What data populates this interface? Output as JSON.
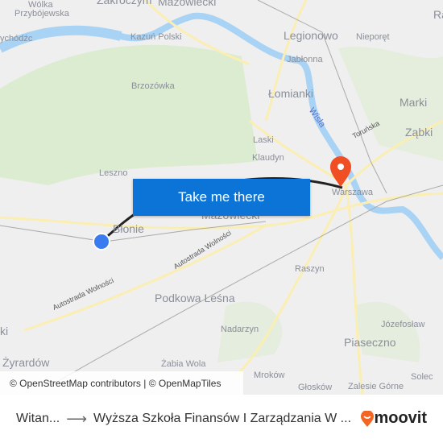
{
  "map": {
    "labels": {
      "wolka": "Wólka",
      "przybojewska": "Przybójewska",
      "ychodzc": "ychódźc",
      "zakroczym": "Zakroczym",
      "mazowiecki_top": "Mazowiecki",
      "kazun": "Kazuń Polski",
      "brzozowka": "Brzozówka",
      "leszno": "Leszno",
      "legionowo": "Legionowo",
      "jablonna": "Jabłonna",
      "lomianki": "Łomianki",
      "wisla": "Wisła",
      "nieporet": "Nieporęt",
      "ra": "Ra",
      "marki": "Marki",
      "zabki": "Ząbki",
      "torunska": "Toruńska",
      "laski": "Laski",
      "klaudyn": "Klaudyn",
      "warszawa": "Warszawa",
      "blonie": "Błonie",
      "mazowiecki_mid": "Mazowiecki",
      "autostrada1": "Autostrada Wolności",
      "autostrada2": "Autostrada Wolności",
      "raszyn": "Raszyn",
      "podkowa": "Podkowa Leśna",
      "nadarzyn": "Nadarzyn",
      "jozefoslaw": "Józefosław",
      "piaseczno": "Piaseczno",
      "zyrardow": "Żyrardów",
      "ki": "ki",
      "mrokow": "Mroków",
      "gloskow": "Głosków",
      "solec": "Solec",
      "zalesie": "Zalesie Górne",
      "zabia": "Żabia Wola"
    },
    "cta_label": "Take me there",
    "attribution": "© OpenStreetMap contributors | © OpenMapTiles",
    "origin_color": "#3a7bf0",
    "destination_color": "#f04e23",
    "button_color": "#0b74d6"
  },
  "footer": {
    "origin": "Witan...",
    "destination": "Wyższa Szkoła Finansów I Zarządzania W ...",
    "brand": "moovit",
    "brand_color": "#f26522"
  }
}
